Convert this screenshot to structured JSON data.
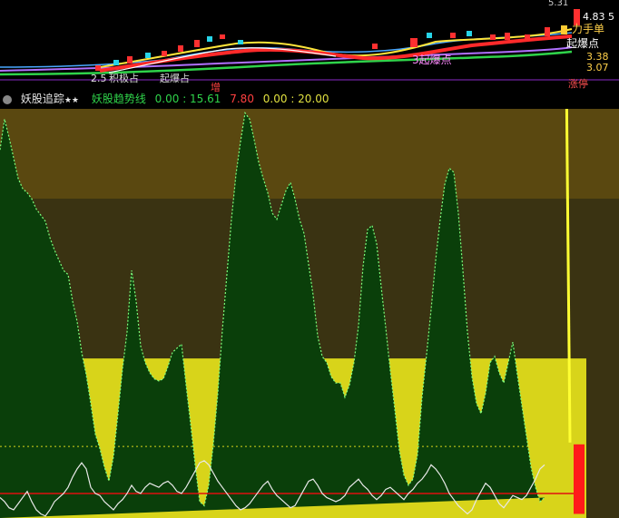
{
  "colors": {
    "upper_band": "#5a4810",
    "lower_band": "#3a3312",
    "mountain": "#0a3f0a",
    "mountain_edge": "#7dff7d",
    "yellow_fill": "#d8d41a",
    "red_line": "#e01010",
    "white_line": "#e8e8e8",
    "pointer_arrow": "#ffff33",
    "bar_red": "#ff1a1a"
  },
  "top_panel": {
    "labels": {
      "price_top": "5.31",
      "price_mid": "4.83",
      "price_mid2": "5",
      "price_low1": "3.38",
      "price_low2": "3.07",
      "left_price": "2.5",
      "marker_a": "3起爆点",
      "marker_b": "起爆点",
      "marker_c": "力手单",
      "marker_d": "涨停",
      "marker_e": "积极占",
      "marker_f": "起爆占"
    }
  },
  "info_bar": {
    "panel_icon": "panel-icon",
    "title": "妖股追踪",
    "stars": "★★",
    "indicator_name": "妖股趋势线",
    "value_1": "0.00 : 15.61",
    "value_2": "7.80",
    "value_3": "0.00 : 20.00",
    "annotation": "增"
  },
  "chart_data": {
    "type": "area",
    "title": "妖股趋势线",
    "ylim": [
      0,
      20
    ],
    "thresholds": {
      "upper": 15.61,
      "yellow_level": 7.8,
      "dotted": 3.5,
      "red_line": 1.2
    },
    "x": [
      0,
      5,
      10,
      15,
      20,
      25,
      30,
      35,
      40,
      45,
      50,
      55,
      60,
      65,
      70,
      75,
      80,
      85,
      90,
      95,
      100,
      105,
      110,
      115,
      120,
      125,
      130,
      135,
      140,
      145,
      150,
      155,
      160,
      165,
      170,
      175,
      180,
      185,
      190,
      195,
      200,
      205,
      210,
      215,
      220,
      225,
      230,
      235,
      240,
      245,
      250,
      255,
      260,
      265,
      270,
      275,
      280,
      285,
      290,
      295,
      300,
      305,
      310,
      315,
      320,
      325,
      330,
      335,
      340,
      345,
      350,
      355,
      360,
      365,
      370,
      375,
      380,
      385,
      390,
      395,
      400,
      405,
      410,
      415,
      420,
      425,
      430,
      435,
      440,
      445,
      450,
      455,
      460,
      465,
      470,
      475,
      480,
      485,
      490,
      495,
      500,
      505,
      510,
      515,
      520,
      525,
      530,
      535,
      540,
      545,
      550,
      555,
      560,
      565,
      570,
      575,
      580,
      585,
      590,
      595,
      600,
      605,
      610,
      615,
      620,
      625,
      630
    ],
    "series": [
      {
        "name": "妖股趋势线",
        "values": [
          18.0,
          19.5,
          18.6,
          17.6,
          16.6,
          16.1,
          15.9,
          15.6,
          15.1,
          14.8,
          14.5,
          13.7,
          13.1,
          12.6,
          12.1,
          11.9,
          10.6,
          9.6,
          8.1,
          7.0,
          5.6,
          4.1,
          3.4,
          2.5,
          1.8,
          3.0,
          5.1,
          7.3,
          9.1,
          12.1,
          10.6,
          8.4,
          7.6,
          7.1,
          6.8,
          6.7,
          6.8,
          7.4,
          8.1,
          8.3,
          8.5,
          6.5,
          4.6,
          2.6,
          0.8,
          0.6,
          1.6,
          3.6,
          6.1,
          9.2,
          11.9,
          14.6,
          16.8,
          18.4,
          19.8,
          19.5,
          18.5,
          17.4,
          16.6,
          15.9,
          14.9,
          14.6,
          15.3,
          16.0,
          16.4,
          15.6,
          14.6,
          13.9,
          12.4,
          10.9,
          8.9,
          7.9,
          7.6,
          6.9,
          6.6,
          6.6,
          5.9,
          6.5,
          7.6,
          9.4,
          12.3,
          14.1,
          14.3,
          13.4,
          11.3,
          9.3,
          7.2,
          5.3,
          3.3,
          2.1,
          1.6,
          1.9,
          3.1,
          5.9,
          8.0,
          10.2,
          12.6,
          14.6,
          16.3,
          17.1,
          16.9,
          14.9,
          12.1,
          9.1,
          6.9,
          5.6,
          5.1,
          6.1,
          7.6,
          7.9,
          7.1,
          6.6,
          7.6,
          8.6,
          7.0,
          5.5,
          4.0,
          2.5,
          1.5,
          0.8,
          1.0
        ]
      },
      {
        "name": "white",
        "values": [
          1.0,
          0.8,
          0.5,
          0.4,
          0.7,
          1.0,
          1.3,
          0.8,
          0.4,
          0.2,
          0.1,
          0.4,
          0.8,
          1.0,
          1.2,
          1.5,
          2.0,
          2.4,
          2.7,
          2.4,
          1.5,
          1.2,
          1.1,
          0.8,
          0.6,
          0.4,
          0.7,
          0.9,
          1.2,
          1.6,
          1.3,
          1.2,
          1.5,
          1.7,
          1.6,
          1.5,
          1.7,
          1.8,
          1.6,
          1.3,
          1.2,
          1.5,
          1.9,
          2.3,
          2.7,
          2.8,
          2.6,
          2.2,
          1.8,
          1.5,
          1.2,
          0.9,
          0.6,
          0.4,
          0.5,
          0.7,
          1.0,
          1.3,
          1.6,
          1.8,
          1.4,
          1.1,
          0.9,
          0.7,
          0.5,
          0.6,
          1.0,
          1.4,
          1.8,
          1.9,
          1.6,
          1.2,
          1.0,
          0.9,
          0.8,
          0.9,
          1.1,
          1.5,
          1.7,
          1.9,
          1.6,
          1.4,
          1.1,
          0.9,
          1.1,
          1.4,
          1.5,
          1.3,
          1.1,
          0.9,
          1.2,
          1.4,
          1.7,
          1.9,
          2.2,
          2.6,
          2.4,
          2.1,
          1.7,
          1.2,
          0.9,
          0.6,
          0.4,
          0.2,
          0.4,
          0.9,
          1.3,
          1.7,
          1.5,
          1.1,
          0.7,
          0.5,
          0.8,
          1.1,
          1.0,
          0.9,
          1.1,
          1.5,
          1.9,
          2.4,
          2.6
        ]
      }
    ],
    "bar": {
      "x": 640,
      "from": 3.6,
      "to": 0.2
    }
  }
}
